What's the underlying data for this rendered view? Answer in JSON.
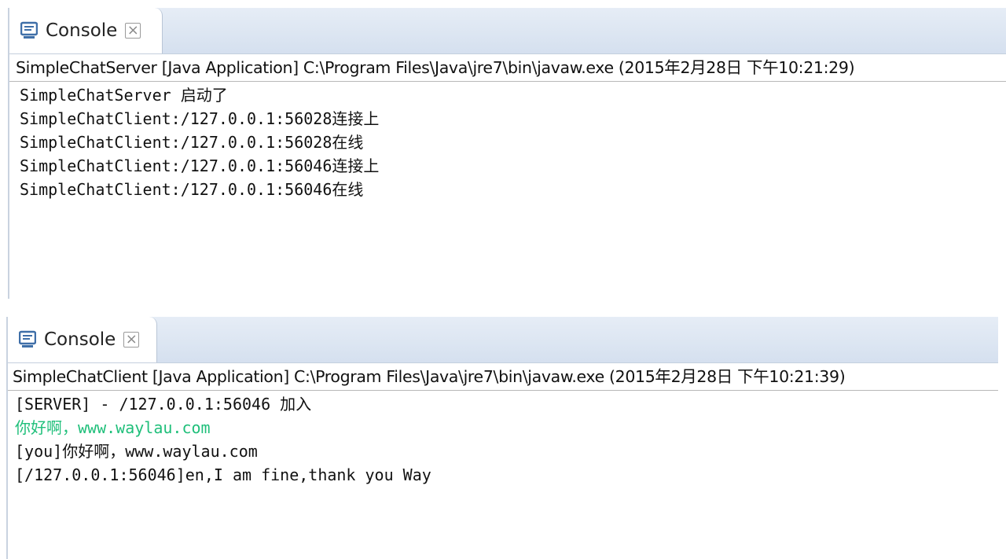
{
  "server_console": {
    "tab_label": "Console",
    "description": "SimpleChatServer [Java Application] C:\\Program Files\\Java\\jre7\\bin\\javaw.exe (2015年2月28日 下午10:21:29)",
    "lines": [
      "SimpleChatServer 启动了",
      "SimpleChatClient:/127.0.0.1:56028连接上",
      "SimpleChatClient:/127.0.0.1:56028在线",
      "SimpleChatClient:/127.0.0.1:56046连接上",
      "SimpleChatClient:/127.0.0.1:56046在线"
    ]
  },
  "client_console": {
    "tab_label": "Console",
    "description": "SimpleChatClient [Java Application] C:\\Program Files\\Java\\jre7\\bin\\javaw.exe (2015年2月28日 下午10:21:39)",
    "lines": [
      "[SERVER] - /127.0.0.1:56046 加入",
      "你好啊，www.waylau.com",
      "[you]你好啊，www.waylau.com",
      "[/127.0.0.1:56046]en,I am fine,thank you Way"
    ]
  },
  "icons": {
    "console": "console-monitor-icon",
    "close": "close-x-icon"
  },
  "colors": {
    "input_text": "#1fbf7a",
    "tab_bar": "#d5e0ef",
    "console_icon": "#3f6fa8"
  }
}
